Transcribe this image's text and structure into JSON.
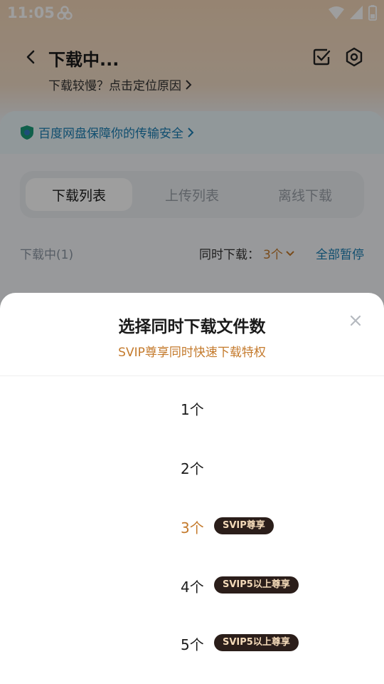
{
  "status_bar": {
    "time": "11:05"
  },
  "header": {
    "title": "下载中...",
    "subtitle": "下载较慢？点击定位原因"
  },
  "security": {
    "text": "百度网盘保障你的传输安全"
  },
  "tabs": [
    {
      "label": "下载列表",
      "active": true
    },
    {
      "label": "上传列表",
      "active": false
    },
    {
      "label": "离线下载",
      "active": false
    }
  ],
  "list_header": {
    "section": "下载中(1)",
    "concurrency_label": "同时下载：",
    "concurrency_value": "3个",
    "pause_all": "全部暂停"
  },
  "sheet": {
    "title": "选择同时下载文件数",
    "subtitle": "SVIP尊享同时快速下载特权",
    "options": [
      {
        "label": "1个",
        "badge": "",
        "selected": false
      },
      {
        "label": "2个",
        "badge": "",
        "selected": false
      },
      {
        "label": "3个",
        "badge": "SVIP尊享",
        "selected": true
      },
      {
        "label": "4个",
        "badge": "SVIP5以上尊享",
        "selected": false
      },
      {
        "label": "5个",
        "badge": "SVIP5以上尊享",
        "selected": false
      }
    ]
  },
  "colors": {
    "accent": "#c47a2c",
    "link": "#1b7fb4",
    "badge_bg": "#2b1e1a",
    "badge_text": "#f3d9b8"
  },
  "icons": [
    "wifi-icon",
    "signal-icon",
    "battery-icon",
    "back-arrow-icon",
    "checkbox-icon",
    "settings-icon",
    "shield-icon",
    "close-icon"
  ]
}
